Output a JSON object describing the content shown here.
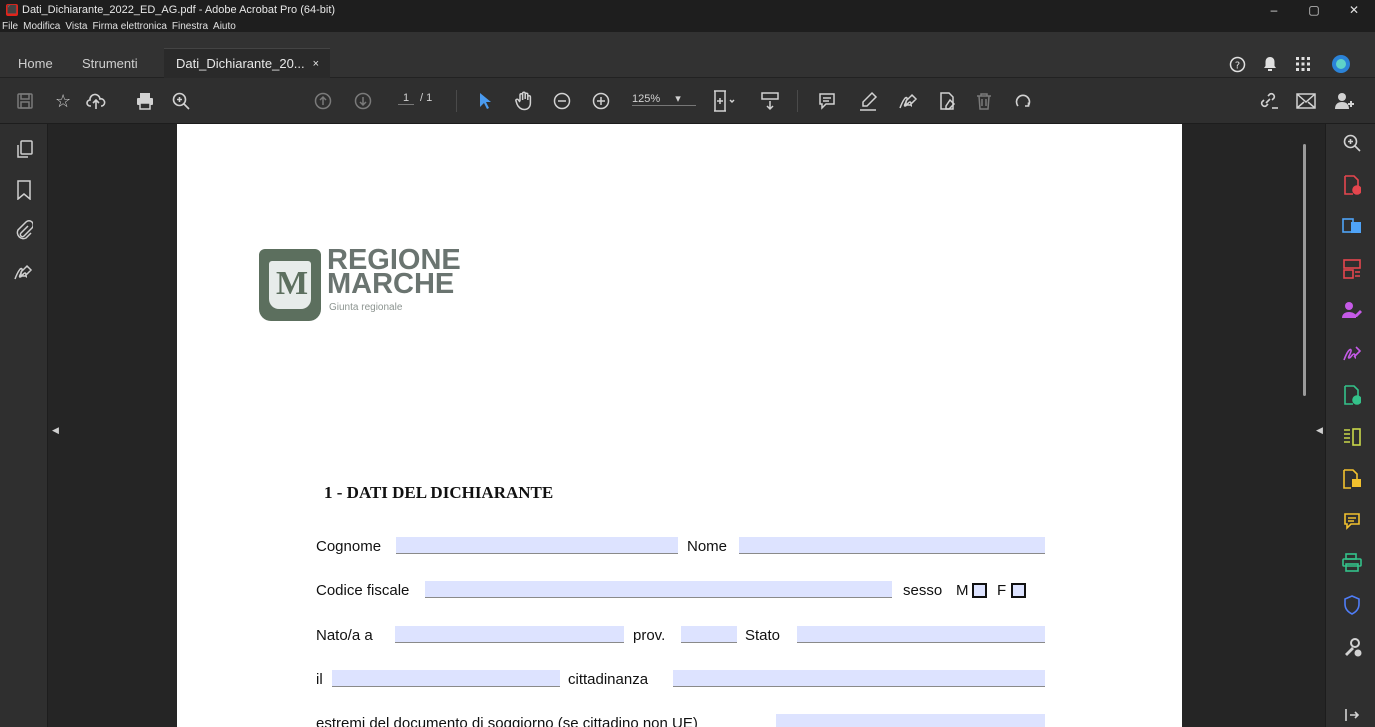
{
  "window": {
    "title": "Dati_Dichiarante_2022_ED_AG.pdf - Adobe Acrobat Pro (64-bit)",
    "controls": [
      "–",
      "▢",
      "✕"
    ]
  },
  "menu": [
    "File",
    "Modifica",
    "Vista",
    "Firma elettronica",
    "Finestra",
    "Aiuto"
  ],
  "tabs": {
    "home": "Home",
    "tools": "Strumenti",
    "document": "Dati_Dichiarante_20...",
    "close_glyph": "×"
  },
  "tab_icons": [
    "help-icon",
    "bell-icon",
    "apps-grid-icon",
    "account-icon"
  ],
  "toolbar": {
    "page_current": "1",
    "page_total": "/ 1",
    "zoom": "125%",
    "zoom_caret": "▾"
  },
  "document": {
    "logo": {
      "line1": "REGIONE",
      "line2": "MARCHE",
      "subtitle": "Giunta regionale"
    },
    "section_title": "1 - DATI DEL DICHIARANTE",
    "labels": {
      "cognome": "Cognome",
      "nome": "Nome",
      "codice_fiscale": "Codice fiscale",
      "sesso": "sesso",
      "m": "M",
      "f": "F",
      "nato_a": "Nato/a a",
      "prov": "prov.",
      "stato": "Stato",
      "il": "il",
      "cittadinanza": "cittadinanza",
      "estremi": "estremi del documento di soggiorno (se cittadino non UE)"
    }
  },
  "colors": {
    "field_fill": "#dde3ff",
    "accent_blue": "#4a9bf0",
    "chrome_dark": "#2f2f2f"
  }
}
